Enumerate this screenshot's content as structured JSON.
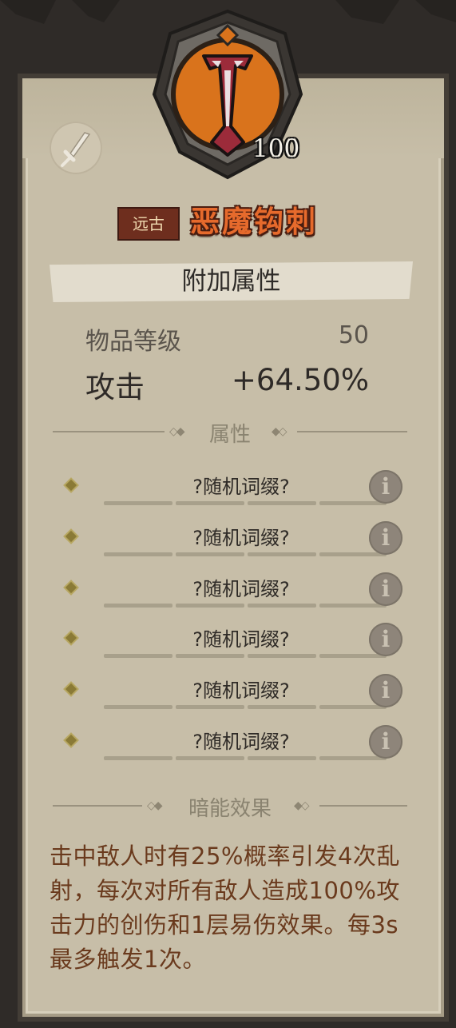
{
  "item": {
    "level": "100",
    "rarity": "远古",
    "name": "恶魔钩刺",
    "icons": {
      "weapon_type": "sword-icon",
      "item": "demon-hook-icon",
      "info": "info-icon"
    }
  },
  "colors": {
    "panel": "#c7bea8",
    "name": "#e66a2c",
    "rarity_bg": "#6e2e1e",
    "emblem_orange": "#d9731c",
    "description": "#6a3a1d"
  },
  "extra_attributes": {
    "title": "附加属性",
    "item_level_label": "物品等级",
    "item_level_value": "50",
    "attack_label": "攻击",
    "attack_value": "+64.50%"
  },
  "attributes_section": {
    "title": "属性",
    "affixes": [
      {
        "text": "?随机词缀?"
      },
      {
        "text": "?随机词缀?"
      },
      {
        "text": "?随机词缀?"
      },
      {
        "text": "?随机词缀?"
      },
      {
        "text": "?随机词缀?"
      },
      {
        "text": "?随机词缀?"
      }
    ]
  },
  "dark_effect": {
    "title": "暗能效果",
    "description": "击中敌人时有25%概率引发4次乱射，每次对所有敌人造成100%攻击力的创伤和1层易伤效果。每3s最多触发1次。"
  }
}
